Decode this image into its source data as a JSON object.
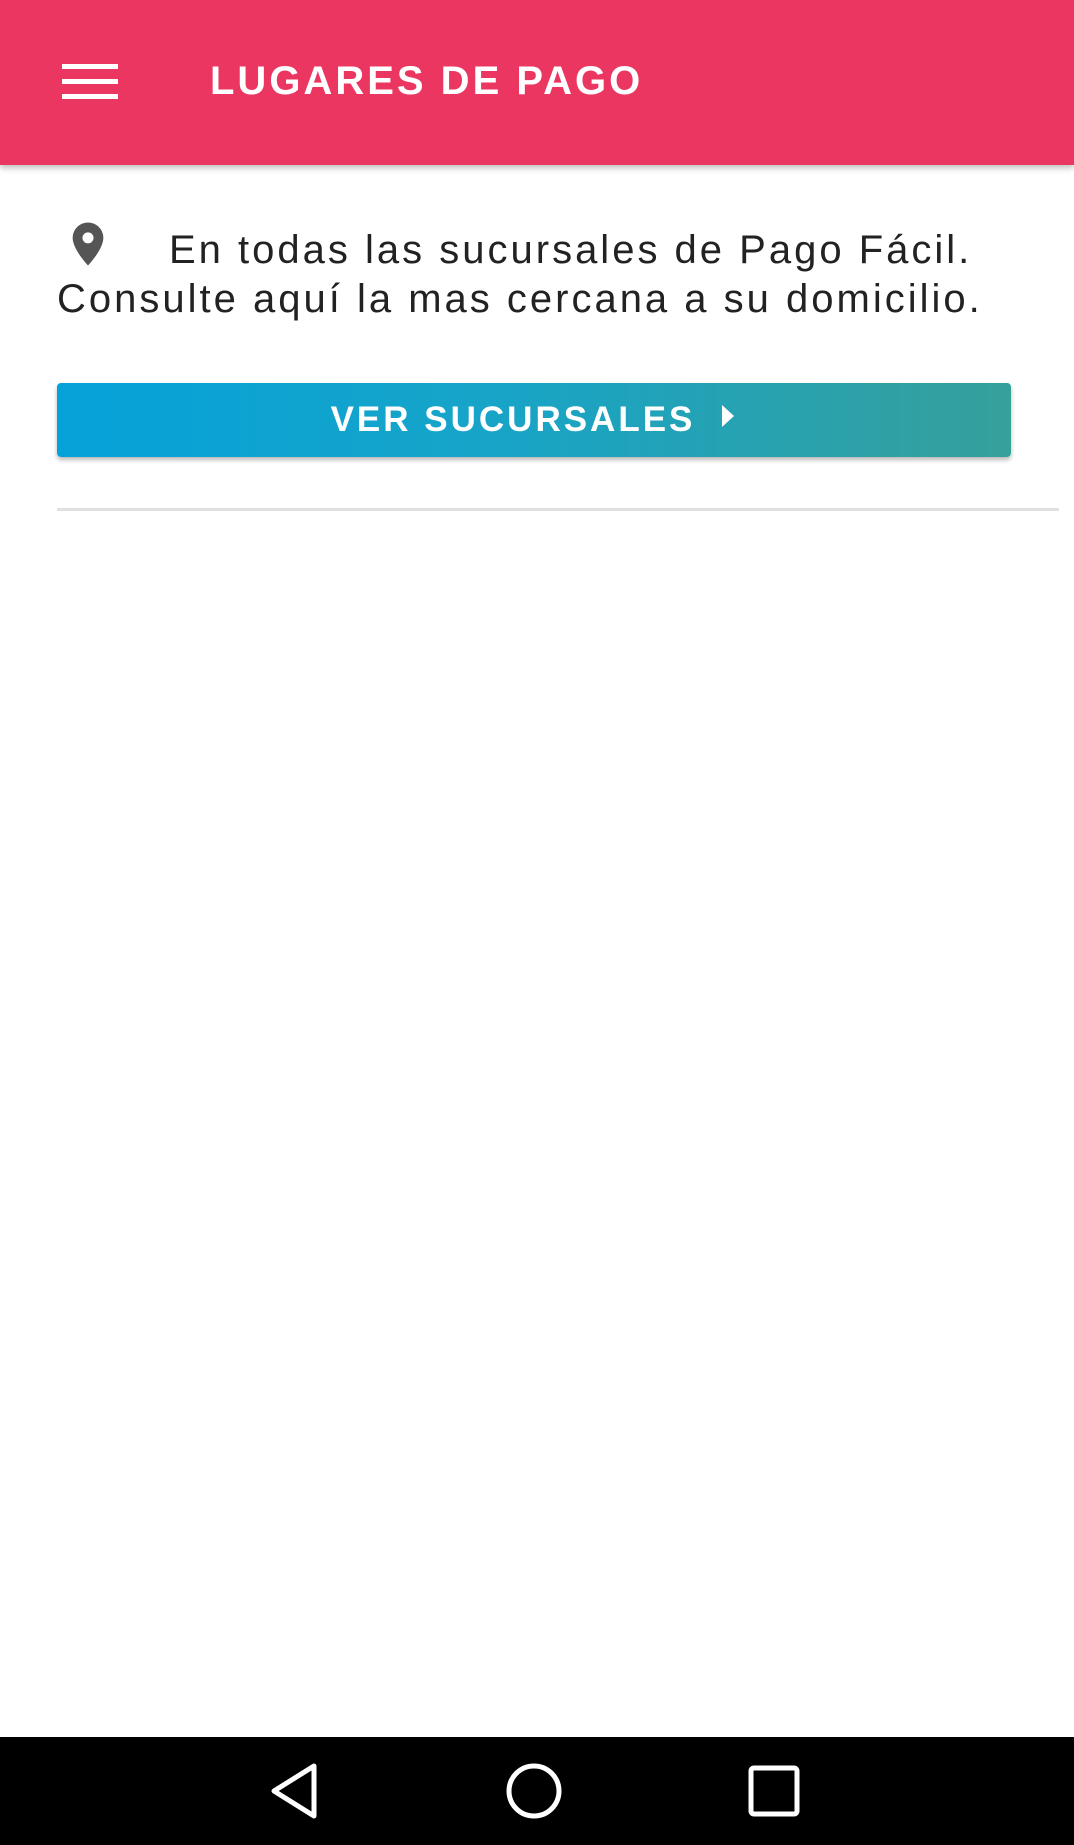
{
  "appbar": {
    "title": "LUGARES DE PAGO",
    "menu_icon": "hamburger-menu-icon",
    "background_color": "#ec3662"
  },
  "info": {
    "icon": "location-pin-icon",
    "text": "En todas las sucursales de Pago Fácil. Consulte aquí la mas cercana a su domicilio."
  },
  "cta": {
    "label": "VER SUCURSALES",
    "icon": "caret-right-icon",
    "gradient_start": "#05a2d9",
    "gradient_end": "#36a09b"
  },
  "system_nav": {
    "back_icon": "back-triangle-icon",
    "home_icon": "home-circle-icon",
    "recents_icon": "recents-square-icon"
  }
}
